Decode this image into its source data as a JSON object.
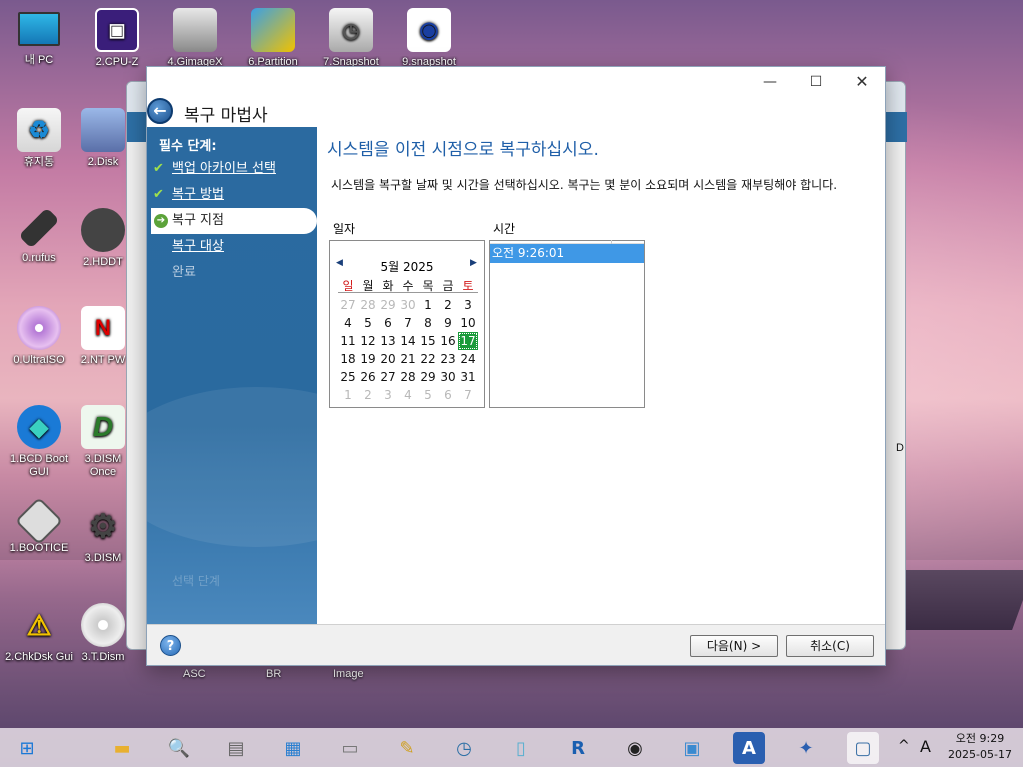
{
  "desktop": {
    "icons": [
      {
        "label": "내 PC"
      },
      {
        "label": "2.CPU-Z"
      },
      {
        "label": "4.GimageX"
      },
      {
        "label": "6.Partition"
      },
      {
        "label": "7.Snapshot"
      },
      {
        "label": "9.snapshot"
      },
      {
        "label": "휴지통"
      },
      {
        "label": "2.Disk"
      },
      {
        "label": "0.rufus"
      },
      {
        "label": "2.HDDT"
      },
      {
        "label": "0.UltraISO"
      },
      {
        "label": "2.NT PW"
      },
      {
        "label": "1.BCD Boot GUI"
      },
      {
        "label": "3.DISM Once"
      },
      {
        "label": "1.BOOTICE"
      },
      {
        "label": "3.DISM"
      },
      {
        "label": "2.ChkDsk Gui"
      },
      {
        "label": "3.T.Dism"
      }
    ],
    "stray_labels": [
      "ASC",
      "BR",
      "Image",
      "D"
    ]
  },
  "wizard": {
    "title": "복구 마법사",
    "sidebar": {
      "heading": "필수 단계:",
      "items": [
        {
          "label": "백업 아카이브 선택",
          "state": "done"
        },
        {
          "label": "복구 방법",
          "state": "done"
        },
        {
          "label": "복구 지점",
          "state": "current"
        },
        {
          "label": "복구 대상",
          "state": "pending"
        },
        {
          "label": "완료",
          "state": "disabled"
        }
      ],
      "faded_label": "선택 단계"
    },
    "content": {
      "heading": "시스템을 이전 시점으로 복구하십시오.",
      "description": "시스템을 복구할 날짜 및 시간을 선택하십시오. 복구는 몇 분이 소요되며 시스템을 재부팅해야 합니다.",
      "date_label": "일자",
      "time_label": "시간",
      "calendar": {
        "month_title": "5월 2025",
        "weekdays": [
          "일",
          "월",
          "화",
          "수",
          "목",
          "금",
          "토"
        ],
        "weeks": [
          [
            "27",
            "28",
            "29",
            "30",
            "1",
            "2",
            "3"
          ],
          [
            "4",
            "5",
            "6",
            "7",
            "8",
            "9",
            "10"
          ],
          [
            "11",
            "12",
            "13",
            "14",
            "15",
            "16",
            "17"
          ],
          [
            "18",
            "19",
            "20",
            "21",
            "22",
            "23",
            "24"
          ],
          [
            "25",
            "26",
            "27",
            "28",
            "29",
            "30",
            "31"
          ],
          [
            "1",
            "2",
            "3",
            "4",
            "5",
            "6",
            "7"
          ]
        ],
        "selected_day": "17"
      },
      "times": [
        "오전 9:26:01"
      ]
    },
    "footer": {
      "next_label": "다음(N) >",
      "cancel_label": "취소(C)",
      "help_glyph": "?"
    }
  },
  "taskbar": {
    "tray_up": "^",
    "ime": "A",
    "time": "오전 9:29",
    "date": "2025-05-17"
  },
  "colors": {
    "accent_blue": "#2b6aa0",
    "heading_blue": "#1f5fa8",
    "selection_blue": "#3f98e6",
    "today_green": "#1a9a3a",
    "weekend_red": "#d31b1b"
  }
}
